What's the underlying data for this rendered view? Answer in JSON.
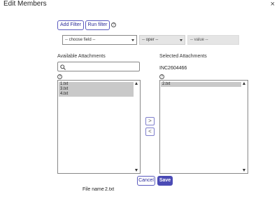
{
  "dialog": {
    "title": "Edit Members",
    "close_glyph": "×"
  },
  "filter": {
    "add_filter_label": "Add Filter",
    "run_filter_label": "Run filter",
    "help_glyph": "?",
    "field_select": "-- choose field --",
    "operator_select": "-- oper --",
    "value_placeholder": "-- value --"
  },
  "available": {
    "heading": "Available Attachments",
    "search_placeholder": "",
    "help_glyph": "?",
    "items": [
      "1.txt",
      "3.txt",
      "4.txt"
    ]
  },
  "selected": {
    "heading": "Selected Attachments",
    "record": "INC2604466",
    "help_glyph": "?",
    "items": [
      "2.txt"
    ]
  },
  "move": {
    "add_glyph": ">",
    "remove_glyph": "<"
  },
  "actions": {
    "cancel_label": "Cancel",
    "save_label": "Save"
  },
  "footer": {
    "file_label": "File name",
    "file_value": "2.txt"
  },
  "colors": {
    "accent": "#4b4bb5",
    "accent_border": "#5b5bbf",
    "selected_item_bg": "#c9c9c9"
  }
}
